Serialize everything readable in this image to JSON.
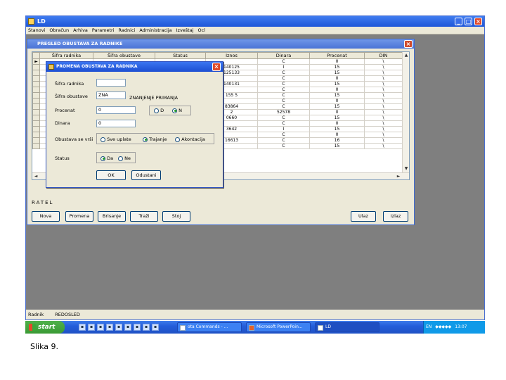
{
  "app": {
    "title": "LD",
    "menu": [
      "Stanovi",
      "Obračun",
      "Arhiva",
      "Parametri",
      "Radnici",
      "Administracija",
      "Izveštaj",
      "Ocl"
    ],
    "status_items": [
      "Radnik",
      "REDOSLED"
    ]
  },
  "pregled": {
    "title": "PREGLED OBUSTAVA ZA RADNIKE",
    "columns": [
      "Šifra radnika",
      "Šifra obustave",
      "Status",
      "Iznos",
      "Dinara",
      "Procenat",
      "DIN"
    ],
    "rows": [
      [
        "",
        "",
        "",
        "",
        "C",
        "0",
        "\\"
      ],
      [
        "",
        "",
        "",
        "140125",
        "I",
        "15",
        "\\"
      ],
      [
        "",
        "",
        "",
        "125133",
        "C",
        "15",
        "\\"
      ],
      [
        "",
        "",
        "",
        "",
        "C",
        "0",
        "\\"
      ],
      [
        "",
        "",
        "",
        "140131",
        "C",
        "15",
        "\\"
      ],
      [
        "",
        "",
        "",
        "",
        "C",
        "0",
        "\\"
      ],
      [
        "",
        "",
        "",
        "155 5",
        "C",
        "15",
        "\\"
      ],
      [
        "",
        "",
        "",
        "",
        "C",
        "0",
        "\\"
      ],
      [
        "",
        "",
        "",
        "83864",
        "C",
        "15",
        "\\"
      ],
      [
        "",
        "",
        "",
        "2",
        "52578",
        "0",
        "\\"
      ],
      [
        "",
        "",
        "",
        "0660",
        "C",
        "15",
        "\\"
      ],
      [
        "",
        "",
        "",
        "",
        "C",
        "0",
        "\\"
      ],
      [
        "",
        "",
        "",
        "3642",
        "I",
        "15",
        "\\"
      ],
      [
        "",
        "",
        "",
        "",
        "C",
        "0",
        "\\"
      ],
      [
        "",
        "",
        "",
        "16613",
        "C",
        "16",
        "\\"
      ],
      [
        "",
        "",
        "",
        "",
        "C",
        "15",
        "\\"
      ]
    ],
    "record_label": "RATEL",
    "buttons": {
      "nova": "Nova",
      "promena": "Promena",
      "brisanje": "Brisanje",
      "trazi": "Traži",
      "stoj": "Stoj",
      "ulaz": "Ulaz",
      "izlaz": "Izlaz"
    }
  },
  "dialog": {
    "title": "PROMENA OBUSTAVA ZA RADNIKA",
    "sifra_radnika_label": "Šifra radnika",
    "sifra_radnika_value": "",
    "sifra_obustave_label": "Šifra obustave",
    "sifra_obustave_value": "ZNA",
    "obustava_name": "ZNANJENJE PRIMANJA",
    "procenat_label": "Procenat",
    "procenat_value": "0",
    "dinara_label": "Dinara",
    "dinara_value": "0",
    "type_options": [
      "D",
      "N"
    ],
    "type_selected": "N",
    "obustava_label": "Obustava se vrši",
    "obustava_options": [
      "Sve uplate",
      "Trajanje",
      "Akontacija"
    ],
    "obustava_selected": "Trajanje",
    "status_label": "Status",
    "status_options": [
      "Da",
      "Ne"
    ],
    "status_selected": "Da",
    "ok_label": "OK",
    "cancel_label": "Odustani"
  },
  "taskbar": {
    "start_label": "start",
    "tasks": [
      "ota Commands - ...",
      "Microsoft PowerPoin...",
      "LD"
    ],
    "tray_text": "EN",
    "clock": "13:07"
  },
  "caption": "Slika 9."
}
